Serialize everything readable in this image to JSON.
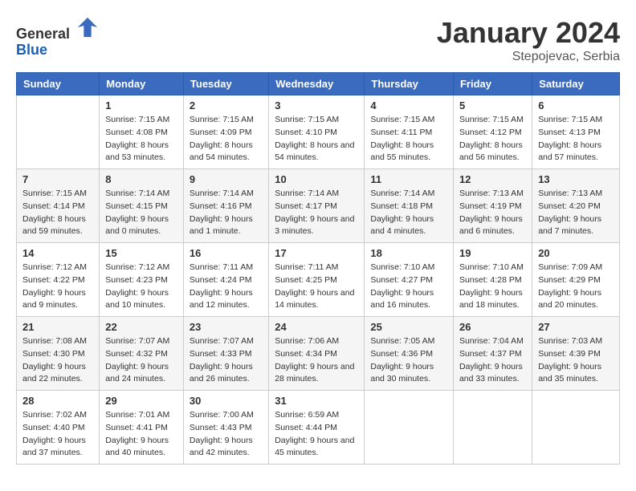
{
  "header": {
    "logo_general": "General",
    "logo_blue": "Blue",
    "month": "January 2024",
    "location": "Stepojevac, Serbia"
  },
  "days_of_week": [
    "Sunday",
    "Monday",
    "Tuesday",
    "Wednesday",
    "Thursday",
    "Friday",
    "Saturday"
  ],
  "weeks": [
    [
      {
        "day": "",
        "sunrise": "",
        "sunset": "",
        "daylight": ""
      },
      {
        "day": "1",
        "sunrise": "Sunrise: 7:15 AM",
        "sunset": "Sunset: 4:08 PM",
        "daylight": "Daylight: 8 hours and 53 minutes."
      },
      {
        "day": "2",
        "sunrise": "Sunrise: 7:15 AM",
        "sunset": "Sunset: 4:09 PM",
        "daylight": "Daylight: 8 hours and 54 minutes."
      },
      {
        "day": "3",
        "sunrise": "Sunrise: 7:15 AM",
        "sunset": "Sunset: 4:10 PM",
        "daylight": "Daylight: 8 hours and 54 minutes."
      },
      {
        "day": "4",
        "sunrise": "Sunrise: 7:15 AM",
        "sunset": "Sunset: 4:11 PM",
        "daylight": "Daylight: 8 hours and 55 minutes."
      },
      {
        "day": "5",
        "sunrise": "Sunrise: 7:15 AM",
        "sunset": "Sunset: 4:12 PM",
        "daylight": "Daylight: 8 hours and 56 minutes."
      },
      {
        "day": "6",
        "sunrise": "Sunrise: 7:15 AM",
        "sunset": "Sunset: 4:13 PM",
        "daylight": "Daylight: 8 hours and 57 minutes."
      }
    ],
    [
      {
        "day": "7",
        "sunrise": "Sunrise: 7:15 AM",
        "sunset": "Sunset: 4:14 PM",
        "daylight": "Daylight: 8 hours and 59 minutes."
      },
      {
        "day": "8",
        "sunrise": "Sunrise: 7:14 AM",
        "sunset": "Sunset: 4:15 PM",
        "daylight": "Daylight: 9 hours and 0 minutes."
      },
      {
        "day": "9",
        "sunrise": "Sunrise: 7:14 AM",
        "sunset": "Sunset: 4:16 PM",
        "daylight": "Daylight: 9 hours and 1 minute."
      },
      {
        "day": "10",
        "sunrise": "Sunrise: 7:14 AM",
        "sunset": "Sunset: 4:17 PM",
        "daylight": "Daylight: 9 hours and 3 minutes."
      },
      {
        "day": "11",
        "sunrise": "Sunrise: 7:14 AM",
        "sunset": "Sunset: 4:18 PM",
        "daylight": "Daylight: 9 hours and 4 minutes."
      },
      {
        "day": "12",
        "sunrise": "Sunrise: 7:13 AM",
        "sunset": "Sunset: 4:19 PM",
        "daylight": "Daylight: 9 hours and 6 minutes."
      },
      {
        "day": "13",
        "sunrise": "Sunrise: 7:13 AM",
        "sunset": "Sunset: 4:20 PM",
        "daylight": "Daylight: 9 hours and 7 minutes."
      }
    ],
    [
      {
        "day": "14",
        "sunrise": "Sunrise: 7:12 AM",
        "sunset": "Sunset: 4:22 PM",
        "daylight": "Daylight: 9 hours and 9 minutes."
      },
      {
        "day": "15",
        "sunrise": "Sunrise: 7:12 AM",
        "sunset": "Sunset: 4:23 PM",
        "daylight": "Daylight: 9 hours and 10 minutes."
      },
      {
        "day": "16",
        "sunrise": "Sunrise: 7:11 AM",
        "sunset": "Sunset: 4:24 PM",
        "daylight": "Daylight: 9 hours and 12 minutes."
      },
      {
        "day": "17",
        "sunrise": "Sunrise: 7:11 AM",
        "sunset": "Sunset: 4:25 PM",
        "daylight": "Daylight: 9 hours and 14 minutes."
      },
      {
        "day": "18",
        "sunrise": "Sunrise: 7:10 AM",
        "sunset": "Sunset: 4:27 PM",
        "daylight": "Daylight: 9 hours and 16 minutes."
      },
      {
        "day": "19",
        "sunrise": "Sunrise: 7:10 AM",
        "sunset": "Sunset: 4:28 PM",
        "daylight": "Daylight: 9 hours and 18 minutes."
      },
      {
        "day": "20",
        "sunrise": "Sunrise: 7:09 AM",
        "sunset": "Sunset: 4:29 PM",
        "daylight": "Daylight: 9 hours and 20 minutes."
      }
    ],
    [
      {
        "day": "21",
        "sunrise": "Sunrise: 7:08 AM",
        "sunset": "Sunset: 4:30 PM",
        "daylight": "Daylight: 9 hours and 22 minutes."
      },
      {
        "day": "22",
        "sunrise": "Sunrise: 7:07 AM",
        "sunset": "Sunset: 4:32 PM",
        "daylight": "Daylight: 9 hours and 24 minutes."
      },
      {
        "day": "23",
        "sunrise": "Sunrise: 7:07 AM",
        "sunset": "Sunset: 4:33 PM",
        "daylight": "Daylight: 9 hours and 26 minutes."
      },
      {
        "day": "24",
        "sunrise": "Sunrise: 7:06 AM",
        "sunset": "Sunset: 4:34 PM",
        "daylight": "Daylight: 9 hours and 28 minutes."
      },
      {
        "day": "25",
        "sunrise": "Sunrise: 7:05 AM",
        "sunset": "Sunset: 4:36 PM",
        "daylight": "Daylight: 9 hours and 30 minutes."
      },
      {
        "day": "26",
        "sunrise": "Sunrise: 7:04 AM",
        "sunset": "Sunset: 4:37 PM",
        "daylight": "Daylight: 9 hours and 33 minutes."
      },
      {
        "day": "27",
        "sunrise": "Sunrise: 7:03 AM",
        "sunset": "Sunset: 4:39 PM",
        "daylight": "Daylight: 9 hours and 35 minutes."
      }
    ],
    [
      {
        "day": "28",
        "sunrise": "Sunrise: 7:02 AM",
        "sunset": "Sunset: 4:40 PM",
        "daylight": "Daylight: 9 hours and 37 minutes."
      },
      {
        "day": "29",
        "sunrise": "Sunrise: 7:01 AM",
        "sunset": "Sunset: 4:41 PM",
        "daylight": "Daylight: 9 hours and 40 minutes."
      },
      {
        "day": "30",
        "sunrise": "Sunrise: 7:00 AM",
        "sunset": "Sunset: 4:43 PM",
        "daylight": "Daylight: 9 hours and 42 minutes."
      },
      {
        "day": "31",
        "sunrise": "Sunrise: 6:59 AM",
        "sunset": "Sunset: 4:44 PM",
        "daylight": "Daylight: 9 hours and 45 minutes."
      },
      {
        "day": "",
        "sunrise": "",
        "sunset": "",
        "daylight": ""
      },
      {
        "day": "",
        "sunrise": "",
        "sunset": "",
        "daylight": ""
      },
      {
        "day": "",
        "sunrise": "",
        "sunset": "",
        "daylight": ""
      }
    ]
  ]
}
